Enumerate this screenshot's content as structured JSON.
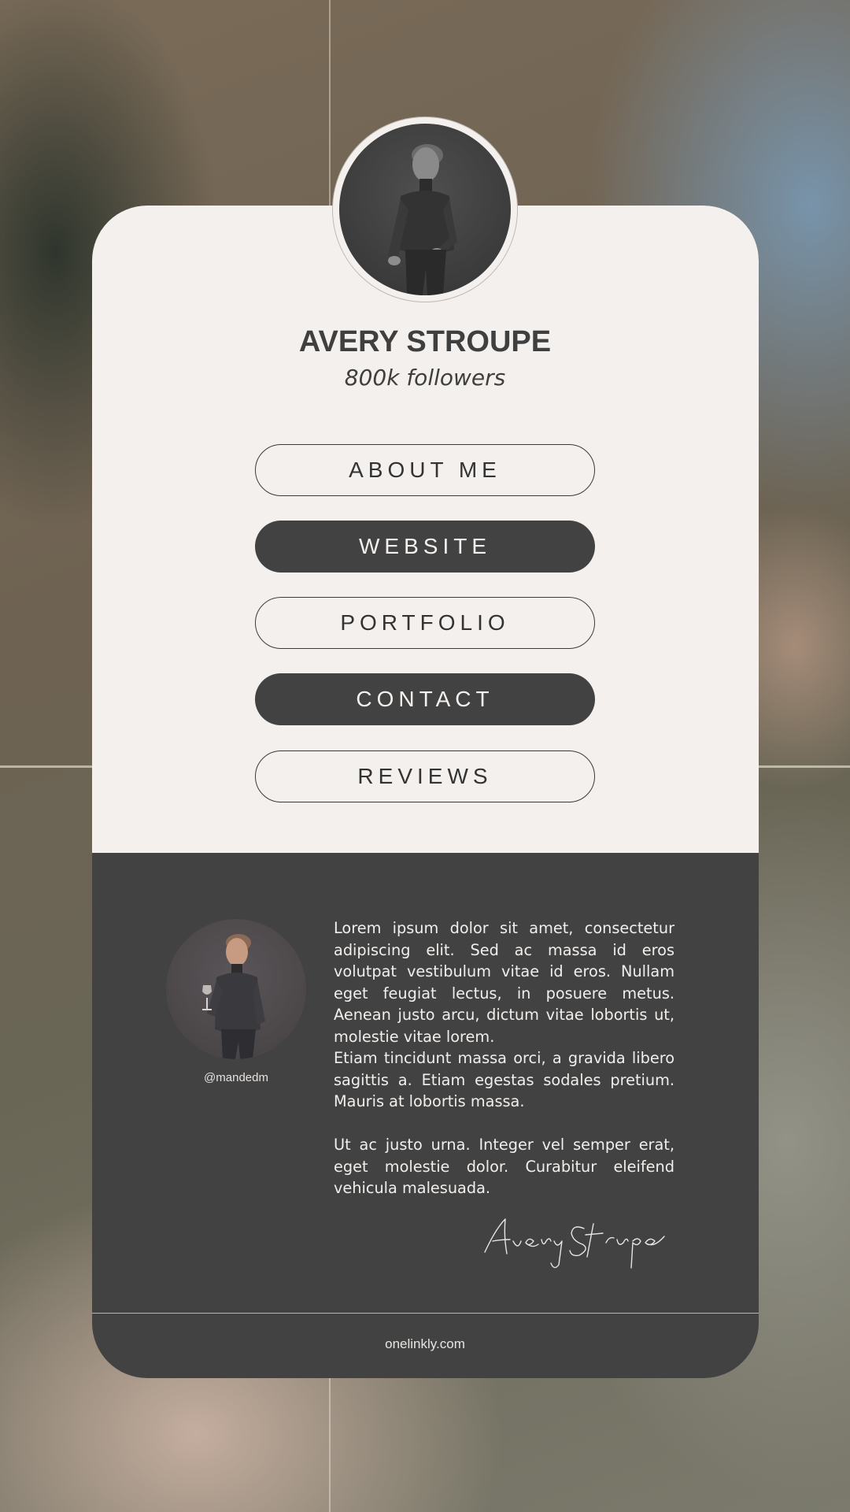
{
  "profile": {
    "name": "AVERY STROUPE",
    "followers": "800k followers",
    "handle": "@mandedm",
    "signature": "Avery Stroupe"
  },
  "links": [
    {
      "label": "ABOUT ME",
      "style": "outline"
    },
    {
      "label": "WEBSITE",
      "style": "filled"
    },
    {
      "label": "PORTFOLIO",
      "style": "outline"
    },
    {
      "label": "CONTACT",
      "style": "filled"
    },
    {
      "label": "REVIEWS",
      "style": "outline"
    }
  ],
  "bio": {
    "paragraphs": [
      "Lorem ipsum dolor sit amet, consectetur adipiscing elit. Sed ac massa id eros volutpat vestibulum vitae id eros. Nullam eget feugiat lectus, in posuere metus. Aenean justo arcu, dictum vitae lobortis ut, molestie vitae lorem.",
      "Etiam tincidunt massa orci, a gravida libero sagittis a. Etiam egestas sodales pretium. Mauris at lobortis massa.",
      "Ut ac justo urna. Integer vel semper erat, eget molestie dolor. Curabitur eleifend vehicula malesuada."
    ]
  },
  "footer": {
    "site": "onelinkly.com"
  },
  "icons": {
    "profile_avatar": "3d-man-avatar-icon",
    "bio_avatar": "3d-man-with-wine-glass-icon"
  },
  "colors": {
    "card_light": "#f3f0ed",
    "card_dark": "#424242",
    "text_dark": "#3f3f3f",
    "text_light": "#f1eeeb"
  }
}
